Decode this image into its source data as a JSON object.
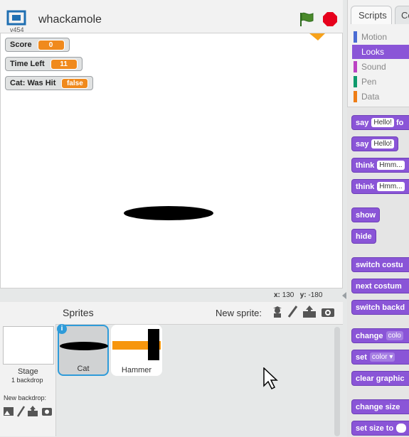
{
  "header": {
    "version": "v454",
    "project_title": "whackamole"
  },
  "monitors": [
    {
      "label": "Score",
      "value": "0"
    },
    {
      "label": "Time Left",
      "value": "11"
    },
    {
      "label": "Cat: Was Hit",
      "value": "false"
    }
  ],
  "coords": {
    "x_label": "x:",
    "x_value": "130",
    "y_label": "y:",
    "y_value": "-180"
  },
  "tabs": {
    "scripts": "Scripts",
    "costumes": "Co"
  },
  "categories": [
    {
      "label": "Motion",
      "color": "#4a6cd4"
    },
    {
      "label": "Looks",
      "color": "#8a55d7"
    },
    {
      "label": "Sound",
      "color": "#bb42c3"
    },
    {
      "label": "Pen",
      "color": "#0e9a6c"
    },
    {
      "label": "Data",
      "color": "#ee7d16"
    }
  ],
  "blocks": [
    {
      "label": "say",
      "input": "Hello!",
      "tail": "fo"
    },
    {
      "label": "say",
      "input": "Hello!",
      "tail": ""
    },
    {
      "label": "think",
      "input": "Hmm...",
      "tail": ""
    },
    {
      "label": "think",
      "input": "Hmm...",
      "tail": ""
    },
    {
      "label": "show",
      "input": "",
      "tail": ""
    },
    {
      "label": "hide",
      "input": "",
      "tail": ""
    },
    {
      "label": "switch costu",
      "input": "",
      "tail": ""
    },
    {
      "label": "next costum",
      "input": "",
      "tail": ""
    },
    {
      "label": "switch backd",
      "input": "",
      "tail": ""
    },
    {
      "label": "change",
      "input": "colo",
      "tail": ""
    },
    {
      "label": "set",
      "input": "color ▾",
      "tail": ""
    },
    {
      "label": "clear graphic",
      "input": "",
      "tail": ""
    },
    {
      "label": "change size",
      "input": "",
      "tail": ""
    },
    {
      "label": "set size to",
      "input": "",
      "tail": ""
    }
  ],
  "sprite_pane": {
    "title": "Sprites",
    "new_sprite_label": "New sprite:",
    "stage_label": "Stage",
    "backdrop_count": "1 backdrop",
    "new_backdrop_label": "New backdrop:",
    "sprites": [
      {
        "name": "Cat",
        "selected": true
      },
      {
        "name": "Hammer",
        "selected": false
      }
    ],
    "info_icon": "i"
  },
  "colors": {
    "looks": "#8a55d7",
    "selection": "#2e9bd9",
    "monitor_value": "#f08a1d"
  }
}
